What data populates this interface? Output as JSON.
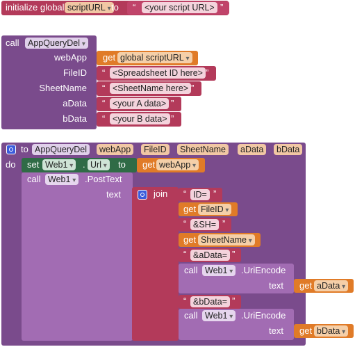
{
  "init_block": {
    "label": "initialize global",
    "var_name": "scriptURL",
    "to": "to",
    "value": "<your script URL>"
  },
  "call_block": {
    "call": "call",
    "proc": "AppQueryDel",
    "params": [
      {
        "name": "webApp",
        "get": "get",
        "var": "global scriptURL"
      },
      {
        "name": "FileID",
        "value": "<Spreadsheet ID here>"
      },
      {
        "name": "SheetName",
        "value": "<SheetName here>"
      },
      {
        "name": "aData",
        "value": "<your A data>"
      },
      {
        "name": "bData",
        "value": "<your B data>"
      }
    ]
  },
  "proc_block": {
    "to": "to",
    "name": "AppQueryDel",
    "params": [
      "webApp",
      "FileID",
      "SheetName",
      "aData",
      "bData"
    ],
    "do": "do",
    "set": "set",
    "set_component": "Web1",
    "set_property": "Url",
    "set_to": "to",
    "get": "get",
    "get_var": "webApp",
    "call": "call",
    "call_component": "Web1",
    "call_method": ".PostText",
    "text_label": "text",
    "join": "join",
    "join_items": [
      "ID=",
      "FileID",
      "&SH=",
      "SheetName",
      "&aData=",
      "aData",
      "&bData=",
      "bData"
    ],
    "uri_encode": ".UriEncode"
  }
}
